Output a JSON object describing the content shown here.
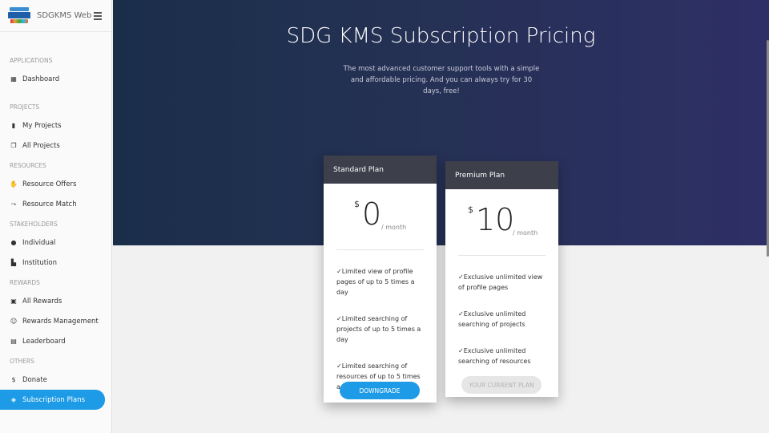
{
  "app": {
    "name": "SDGKMS Web"
  },
  "sidebar": {
    "sections": [
      {
        "title": "APPLICATIONS",
        "items": [
          {
            "label": "Dashboard",
            "icon": "dashboard-icon"
          }
        ]
      },
      {
        "title": "PROJECTS",
        "items": [
          {
            "label": "My Projects",
            "icon": "bookmark-icon"
          },
          {
            "label": "All Projects",
            "icon": "copy-icon"
          }
        ]
      },
      {
        "title": "RESOURCES",
        "items": [
          {
            "label": "Resource Offers",
            "icon": "hand-icon"
          },
          {
            "label": "Resource Match",
            "icon": "match-icon"
          }
        ]
      },
      {
        "title": "STAKEHOLDERS",
        "items": [
          {
            "label": "Individual",
            "icon": "person-icon"
          },
          {
            "label": "Institution",
            "icon": "building-icon"
          }
        ]
      },
      {
        "title": "REWARDS",
        "items": [
          {
            "label": "All Rewards",
            "icon": "gift-icon"
          },
          {
            "label": "Rewards Management",
            "icon": "smile-icon"
          },
          {
            "label": "Leaderboard",
            "icon": "chart-icon"
          }
        ]
      },
      {
        "title": "OTHERS",
        "items": [
          {
            "label": "Donate",
            "icon": "dollar-icon"
          },
          {
            "label": "Subscription Plans",
            "icon": "tag-icon",
            "active": true
          }
        ]
      }
    ]
  },
  "hero": {
    "title": "SDG KMS Subscription Pricing",
    "subtitle": "The most advanced customer support tools with a simple and affordable pricing. And you can always try for 30 days, free!"
  },
  "plans": [
    {
      "name": "Standard Plan",
      "currency": "$",
      "amount": "0",
      "period": "/ month",
      "features": [
        "✓Limited view of profile pages of up to 5 times a day",
        "✓Limited searching of projects of up to 5 times a day",
        "✓Limited searching of resources of up to 5 times a day"
      ],
      "button": "DOWNGRADE"
    },
    {
      "name": "Premium Plan",
      "currency": "$",
      "amount": "10",
      "period": "/ month",
      "features": [
        "✓Exclusive unlimited view of profile pages",
        "✓Exclusive unlimited searching of projects",
        "✓Exclusive unlimited searching of resources"
      ],
      "button": "YOUR CURRENT PLAN"
    }
  ],
  "colors": {
    "accent": "#1e9be6",
    "card_header": "#3d3f4b",
    "hero_start": "#1a2e4a",
    "hero_end": "#2e2f66"
  }
}
